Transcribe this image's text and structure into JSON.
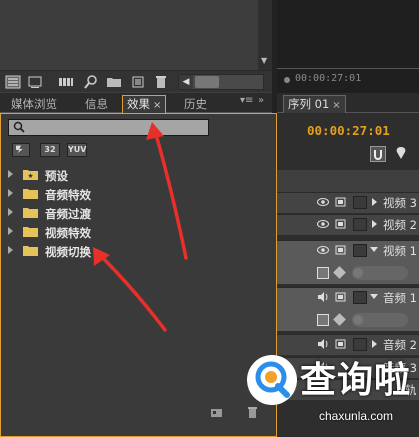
{
  "program_monitor": {
    "timecode": "00:00:27:01"
  },
  "effects_panel": {
    "tabs": [
      {
        "label": "媒体浏览",
        "active": false
      },
      {
        "label": "信息",
        "active": false
      },
      {
        "label": "效果",
        "active": true
      },
      {
        "label": "历史",
        "active": false
      }
    ],
    "search": {
      "value": "",
      "placeholder": ""
    },
    "filter_buttons": [
      "32",
      "YUV"
    ],
    "folders": [
      {
        "label": "预设"
      },
      {
        "label": "音频特效"
      },
      {
        "label": "音频过渡"
      },
      {
        "label": "视频特效"
      },
      {
        "label": "视频切换"
      }
    ]
  },
  "sequence": {
    "tab_label": "序列 01",
    "timecode": "00:00:27:01",
    "tracks": [
      {
        "name": "视频 3",
        "kind": "video",
        "expanded": false
      },
      {
        "name": "视频 2",
        "kind": "video",
        "expanded": false
      },
      {
        "name": "视频 1",
        "kind": "video",
        "expanded": true
      },
      {
        "name": "音频 1",
        "kind": "audio",
        "expanded": true
      },
      {
        "name": "音频 2",
        "kind": "audio",
        "expanded": false
      },
      {
        "name": "音频 3",
        "kind": "audio",
        "expanded": false
      }
    ],
    "partial_label": "轨"
  },
  "watermark": {
    "brand": "查询啦",
    "url": "chaxunla.com"
  },
  "colors": {
    "accent": "#e0a030",
    "timecode": "#e3a020",
    "arrow": "#e8302a"
  }
}
